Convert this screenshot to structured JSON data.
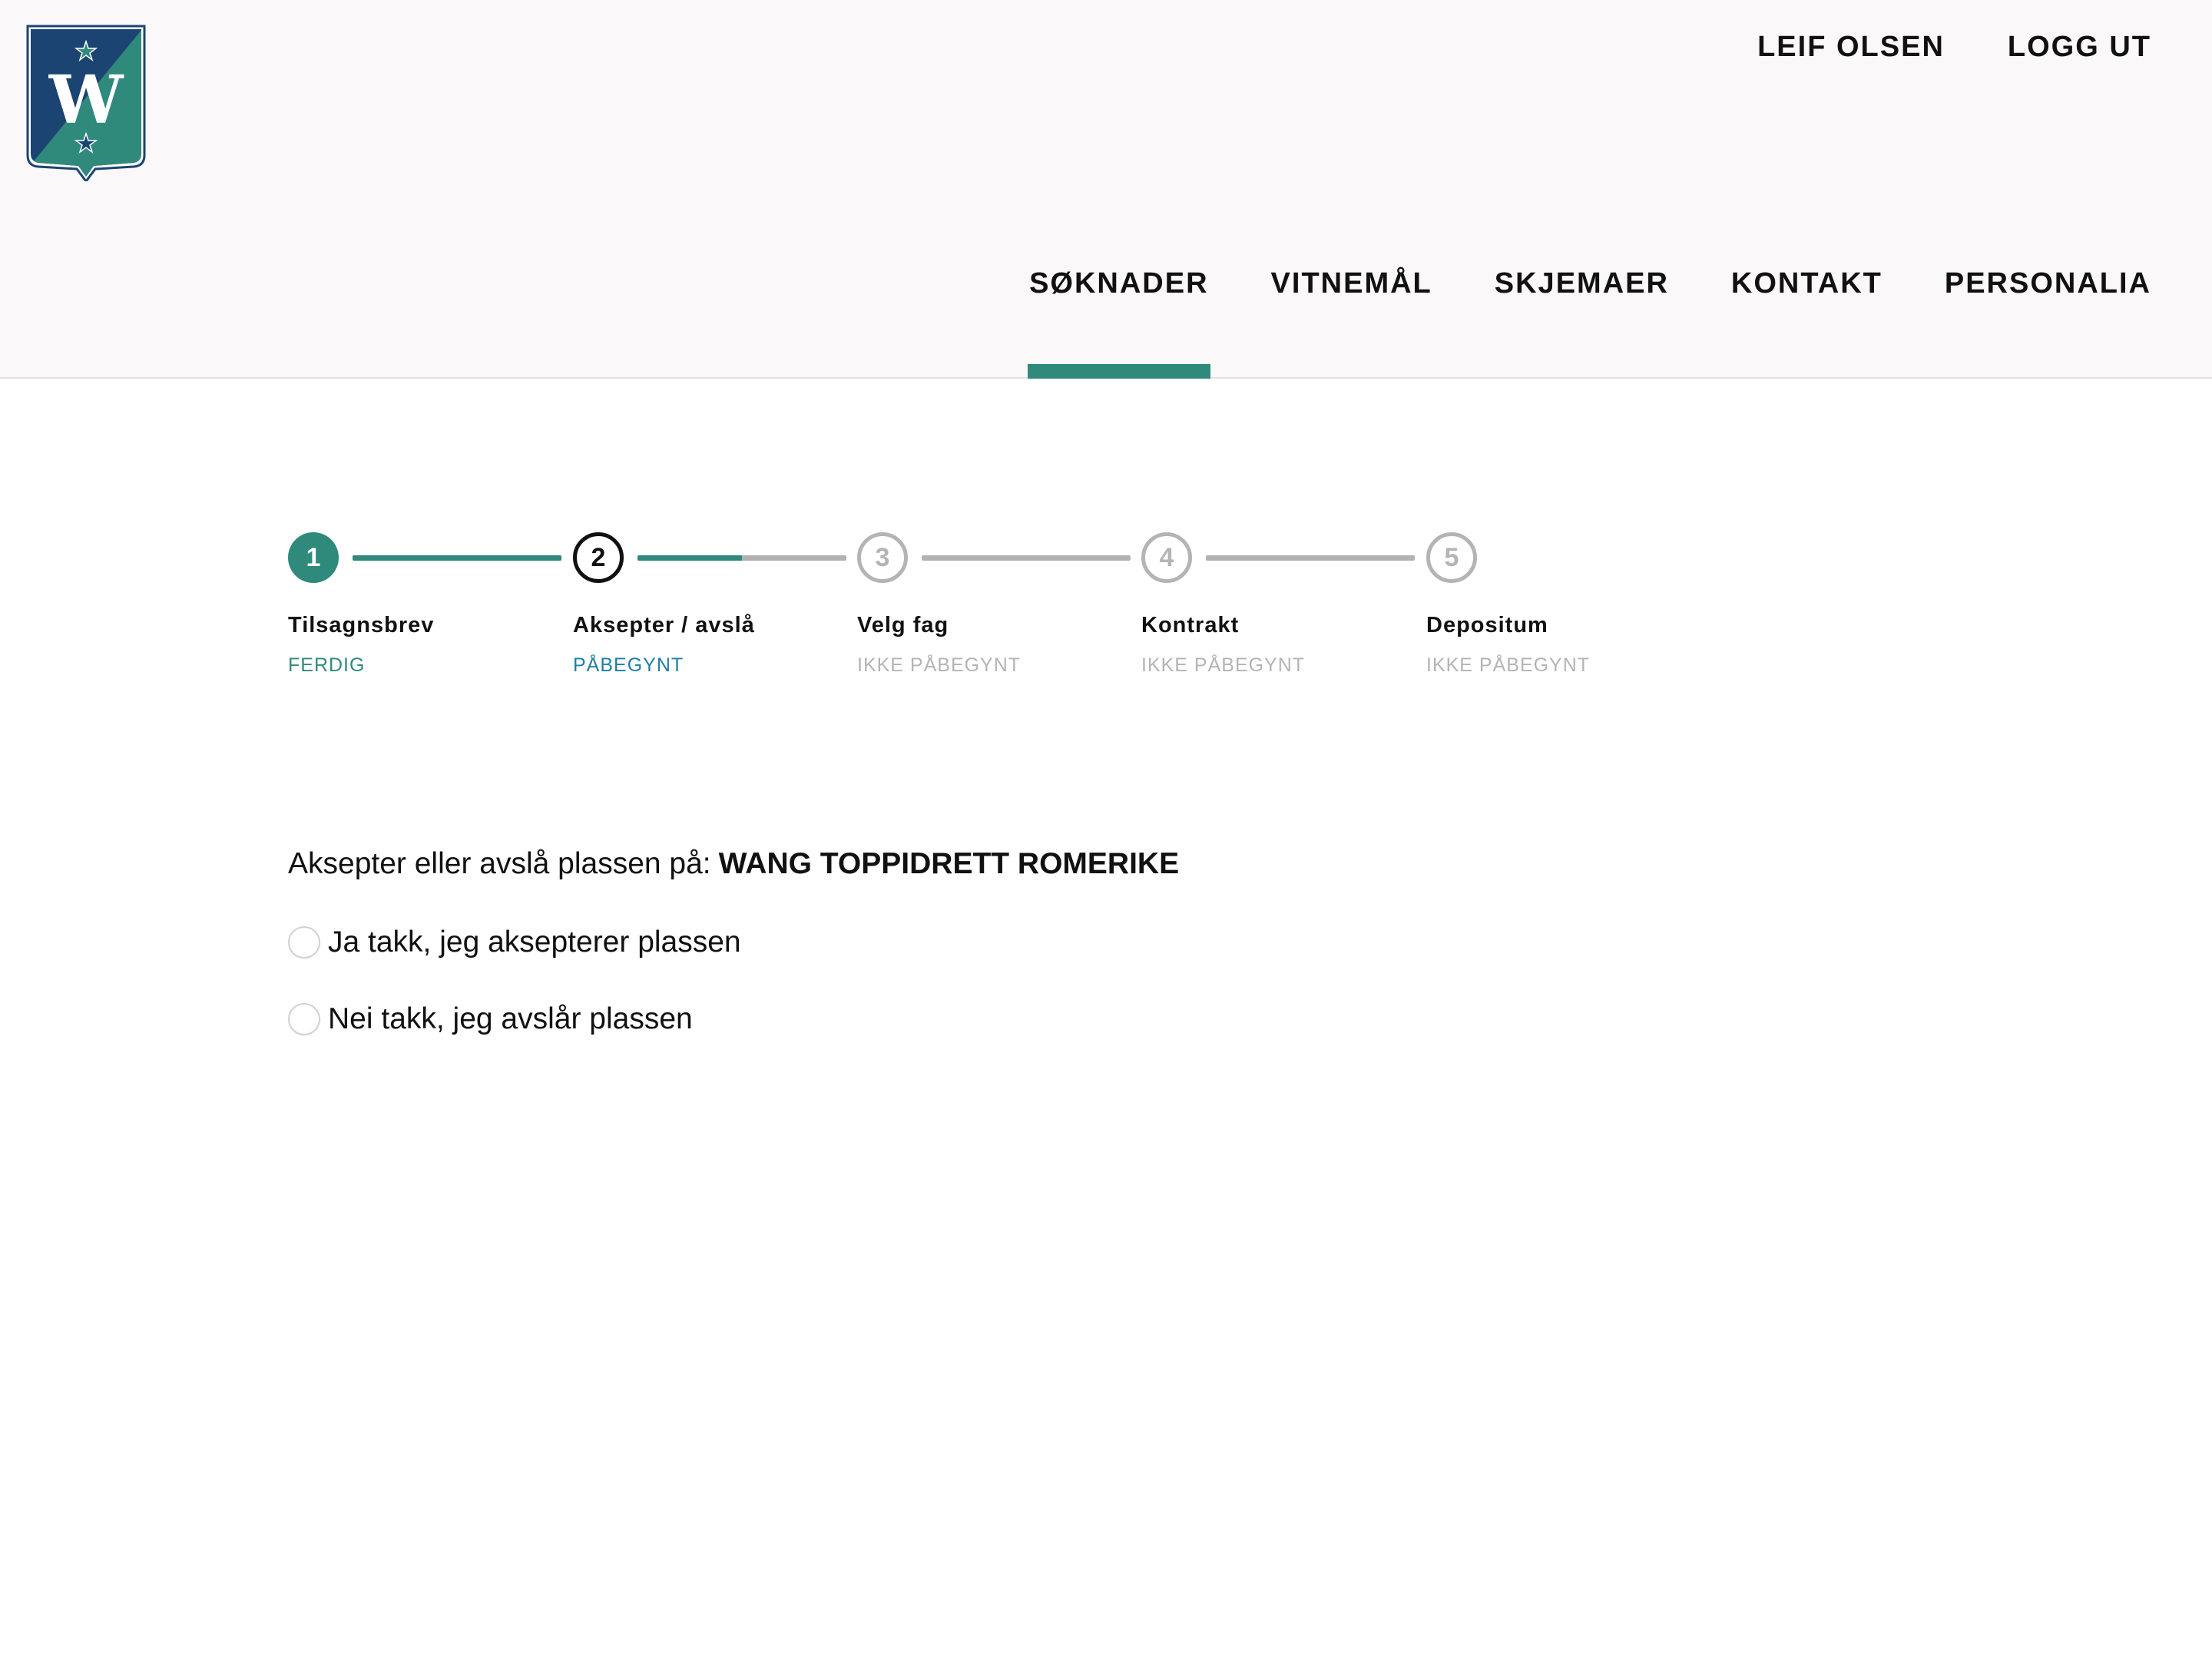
{
  "header": {
    "logo_letter": "W",
    "top_links": [
      "LEIF OLSEN",
      "LOGG UT"
    ],
    "nav": [
      {
        "label": "SØKNADER",
        "active": true
      },
      {
        "label": "VITNEMÅL",
        "active": false
      },
      {
        "label": "SKJEMAER",
        "active": false
      },
      {
        "label": "KONTAKT",
        "active": false
      },
      {
        "label": "PERSONALIA",
        "active": false
      }
    ]
  },
  "stepper": {
    "steps": [
      {
        "number": "1",
        "label": "Tilsagnsbrev",
        "status": "FERDIG",
        "state": "done",
        "progress_to_next": 1.0
      },
      {
        "number": "2",
        "label": "Aksepter / avslå",
        "status": "PÅBEGYNT",
        "state": "current",
        "progress_to_next": 0.5
      },
      {
        "number": "3",
        "label": "Velg fag",
        "status": "IKKE PÅBEGYNT",
        "state": "pending",
        "progress_to_next": 0
      },
      {
        "number": "4",
        "label": "Kontrakt",
        "status": "IKKE PÅBEGYNT",
        "state": "pending",
        "progress_to_next": 0
      },
      {
        "number": "5",
        "label": "Depositum",
        "status": "IKKE PÅBEGYNT",
        "state": "pending"
      }
    ]
  },
  "question": {
    "prompt": "Aksepter eller avslå plassen på:",
    "school": "WANG TOPPIDRETT ROMERIKE",
    "options": [
      {
        "label": "Ja takk, jeg aksepterer plassen",
        "selected": false
      },
      {
        "label": "Nei takk, jeg avslår plassen",
        "selected": false
      }
    ]
  },
  "colors": {
    "accent": "#2f8a7c",
    "in_progress": "#1f7fa6",
    "pending": "#b4b4b4",
    "logo_blue": "#1c4472",
    "logo_green": "#2f8a7c"
  }
}
